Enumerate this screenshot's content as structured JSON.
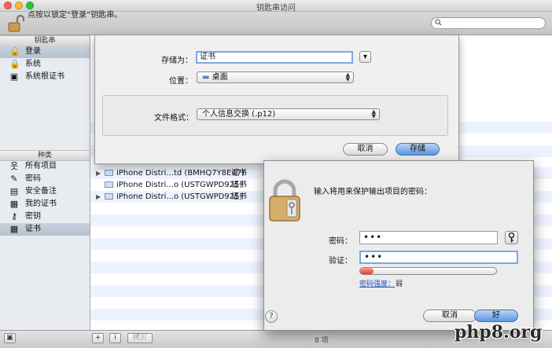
{
  "window": {
    "title": "钥匙串访问"
  },
  "toolbar": {
    "lock_text": "点按以锁定“登录”钥匙串。"
  },
  "sidebar": {
    "keychains_header": "钥匙串",
    "keychains": [
      {
        "label": "登录",
        "icon": "lock-open-icon",
        "selected": true
      },
      {
        "label": "系统",
        "icon": "lock-icon",
        "selected": false
      },
      {
        "label": "系统根证书",
        "icon": "cabinet-icon",
        "selected": false
      }
    ],
    "category_header": "种类",
    "categories": [
      {
        "label": "所有项目",
        "icon": "person-icon",
        "selected": false
      },
      {
        "label": "密码",
        "icon": "pencil-icon",
        "selected": false
      },
      {
        "label": "安全备注",
        "icon": "note-icon",
        "selected": false
      },
      {
        "label": "我的证书",
        "icon": "certificate-icon",
        "selected": false
      },
      {
        "label": "密钥",
        "icon": "key-icon",
        "selected": false
      },
      {
        "label": "证书",
        "icon": "certificate-icon",
        "selected": true
      }
    ]
  },
  "items": [
    {
      "name": "iPhone Distri...td (BMHQ7Y8E47)",
      "kind": "证书",
      "expandable": true
    },
    {
      "name": "iPhone Distri...o (USTGWPD925)",
      "kind": "证书",
      "expandable": false
    },
    {
      "name": "iPhone Distri...o (USTGWPD925)",
      "kind": "证书",
      "expandable": true
    }
  ],
  "status": {
    "item_count": "8 项",
    "copy_button": "拷贝"
  },
  "save_sheet": {
    "save_as_label": "存储为：",
    "save_as_value": "证书",
    "location_label": "位置：",
    "location_value": "桌面",
    "format_label": "文件格式：",
    "format_value": "个人信息交换 (.p12)",
    "cancel": "取消",
    "save": "存储"
  },
  "password_dialog": {
    "prompt": "输入将用来保护输出项目的密码：",
    "password_label": "密码：",
    "password_value": "•••",
    "verify_label": "验证：",
    "verify_value": "•••",
    "strength_link": "密码强度：",
    "strength_value": "弱",
    "strength_fraction": 0.1,
    "help": "?",
    "cancel": "取消",
    "ok": "好"
  },
  "watermark": "php8.org",
  "colors": {
    "accent": "#5b96e3",
    "selection": "#b6c2d0",
    "weak": "#e63a2a"
  }
}
